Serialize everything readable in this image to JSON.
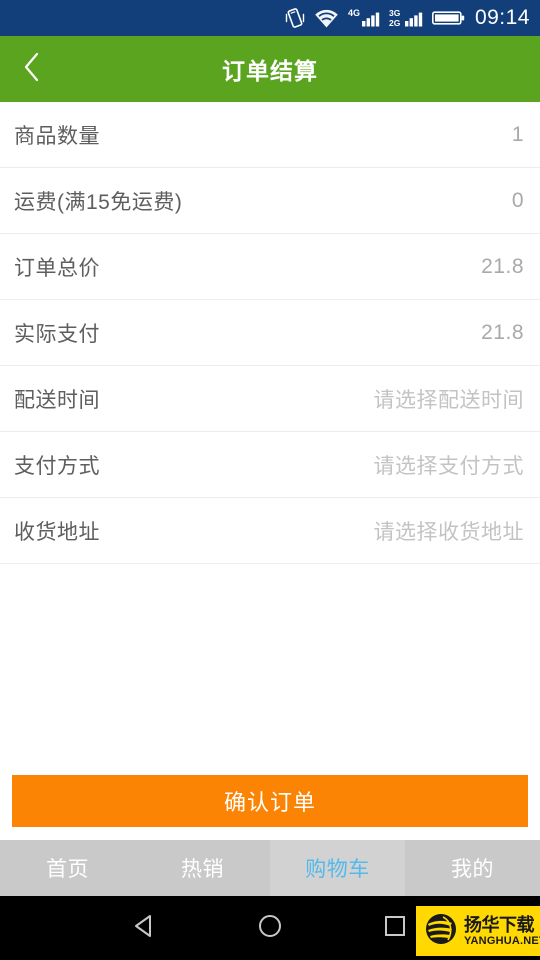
{
  "status_bar": {
    "time": "09:14",
    "icons": [
      {
        "name": "vibrate-icon"
      },
      {
        "name": "wifi-icon"
      },
      {
        "name": "signal-4g-icon",
        "label": "4G"
      },
      {
        "name": "signal-3g-2g-icon",
        "label_top": "3G",
        "label_bottom": "2G"
      },
      {
        "name": "battery-icon"
      }
    ],
    "background_color": "#123f7a"
  },
  "header": {
    "title": "订单结算",
    "back_icon": "chevron-left-icon",
    "background_color": "#5ba420"
  },
  "list": {
    "rows": [
      {
        "label": "商品数量",
        "value": "1",
        "is_placeholder": false
      },
      {
        "label": "运费(满15免运费)",
        "value": "0",
        "is_placeholder": false
      },
      {
        "label": "订单总价",
        "value": "21.8",
        "is_placeholder": false
      },
      {
        "label": "实际支付",
        "value": "21.8",
        "is_placeholder": false
      },
      {
        "label": "配送时间",
        "value": "请选择配送时间",
        "is_placeholder": true
      },
      {
        "label": "支付方式",
        "value": "请选择支付方式",
        "is_placeholder": true
      },
      {
        "label": "收货地址",
        "value": "请选择收货地址",
        "is_placeholder": true
      }
    ]
  },
  "confirm_button": {
    "label": "确认订单",
    "color": "#fc8404"
  },
  "tab_bar": {
    "active_index": 2,
    "active_color": "#56b9ec",
    "tabs": [
      {
        "label": "首页",
        "name": "tab-home"
      },
      {
        "label": "热销",
        "name": "tab-hot-sales"
      },
      {
        "label": "购物车",
        "name": "tab-cart"
      },
      {
        "label": "我的",
        "name": "tab-mine"
      }
    ]
  },
  "nav_bar": {
    "buttons": [
      {
        "name": "nav-back-button",
        "icon": "triangle-back-icon"
      },
      {
        "name": "nav-home-button",
        "icon": "circle-home-icon"
      },
      {
        "name": "nav-recents-button",
        "icon": "square-recents-icon"
      }
    ]
  },
  "watermark": {
    "cn": "扬华下载",
    "en": "YANGHUA.NET",
    "background_color": "#ffd900"
  }
}
